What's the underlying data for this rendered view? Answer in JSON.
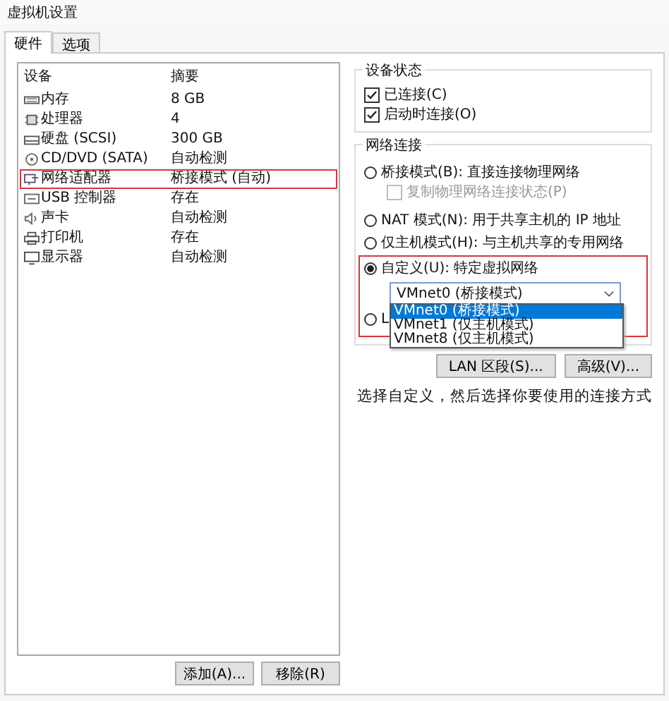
{
  "window": {
    "title": "虚拟机设置"
  },
  "tabs": [
    {
      "label": "硬件",
      "selected": true
    },
    {
      "label": "选项",
      "selected": false
    }
  ],
  "device_list": {
    "columns": [
      "设备",
      "摘要"
    ],
    "rows": [
      {
        "device": "内存",
        "summary": "8 GB",
        "highlighted": false
      },
      {
        "device": "处理器",
        "summary": "4",
        "highlighted": false
      },
      {
        "device": "硬盘 (SCSI)",
        "summary": "300 GB",
        "highlighted": false
      },
      {
        "device": "CD/DVD (SATA)",
        "summary": "自动检测",
        "highlighted": false
      },
      {
        "device": "网络适配器",
        "summary": "桥接模式 (自动)",
        "highlighted": true
      },
      {
        "device": "USB 控制器",
        "summary": "存在",
        "highlighted": false
      },
      {
        "device": "声卡",
        "summary": "自动检测",
        "highlighted": false
      },
      {
        "device": "打印机",
        "summary": "存在",
        "highlighted": false
      },
      {
        "device": "显示器",
        "summary": "自动检测",
        "highlighted": false
      }
    ]
  },
  "list_buttons": [
    "添加(A)...",
    "移除(R)"
  ],
  "device_status": {
    "title": "设备状态",
    "options": [
      {
        "label": "已连接(C)",
        "checked": true
      },
      {
        "label": "启动时连接(O)",
        "checked": true
      }
    ]
  },
  "network_connection": {
    "title": "网络连接",
    "options": [
      {
        "kind": "radio",
        "label": "桥接模式(B): 直接连接物理网络",
        "selected": false
      },
      {
        "kind": "checkbox",
        "label": "复制物理网络连接状态(P)",
        "checked": false,
        "disabled": true
      },
      {
        "kind": "radio",
        "label": "NAT 模式(N): 用于共享主机的 IP 地址",
        "selected": false
      },
      {
        "kind": "radio",
        "label": "仅主机模式(H): 与主机共享的专用网络",
        "selected": false
      }
    ],
    "custom_group": {
      "highlighted": true,
      "radio": {
        "label": "自定义(U): 特定虚拟网络",
        "selected": true
      },
      "dropdown": {
        "value": "VMnet0 (桥接模式)",
        "expanded": true,
        "options": [
          {
            "label": "VMnet0 (桥接模式)",
            "selected": true
          },
          {
            "label": "VMnet1 (仅主机模式)",
            "selected": false
          },
          {
            "label": "VMnet8 (仅主机模式)",
            "selected": false
          }
        ]
      },
      "lan_radio": {
        "label": "L",
        "selected": false
      }
    }
  },
  "network_buttons": [
    "LAN 区段(S)...",
    "高级(V)..."
  ],
  "hint": "选择自定义，然后选择你要使用的连接方式"
}
